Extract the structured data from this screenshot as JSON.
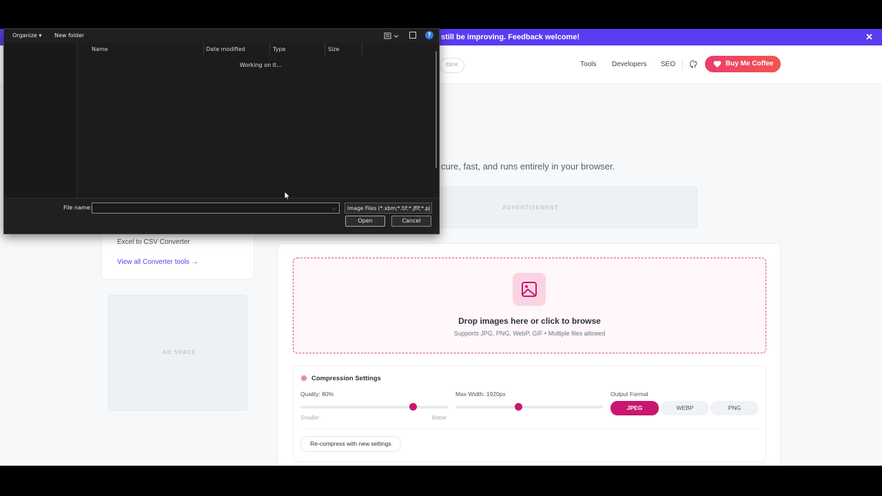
{
  "banner": {
    "text": "still be improving. Feedback welcome!",
    "close": "✕"
  },
  "header": {
    "kbd": "Ctrl K",
    "nav": [
      "Tools",
      "Developers",
      "SEO"
    ],
    "coffee_button": "Buy Me Coffee"
  },
  "hero": {
    "tagline": "cure, fast, and runs entirely in your browser."
  },
  "ads": {
    "top": "ADVERTISEMENT",
    "side": "AD SPACE"
  },
  "sidebar": {
    "item": "Excel to CSV Converter",
    "link": "View all Converter tools →"
  },
  "dropzone": {
    "title": "Drop images here or click to browse",
    "subtitle": "Supports JPG, PNG, WebP, GIF • Multiple files allowed"
  },
  "settings": {
    "title": "Compression Settings",
    "quality_label": "Quality: 80%",
    "quality_value": 80,
    "quality_min": "Smaller",
    "quality_max": "Better",
    "maxwidth_label": "Max Width: 1920px",
    "output_label": "Output Format",
    "formats": [
      "JPEG",
      "WEBP",
      "PNG"
    ],
    "selected_format": "JPEG",
    "recompress": "Re-compress with new settings"
  },
  "dialog": {
    "organize": "Organize ▾",
    "new_folder": "New folder",
    "help": "?",
    "columns": [
      "Name",
      "Date modified",
      "Type",
      "Size"
    ],
    "status": "Working on it...",
    "file_name_label": "File name:",
    "file_name_value": "",
    "file_type": "Image Files (*.xbm;*.tif;*.jfif;*.pj",
    "open": "Open",
    "cancel": "Cancel"
  },
  "colors": {
    "accent": "#c9166e",
    "banner": "#5b3cf0",
    "link": "#5b3cf0"
  }
}
